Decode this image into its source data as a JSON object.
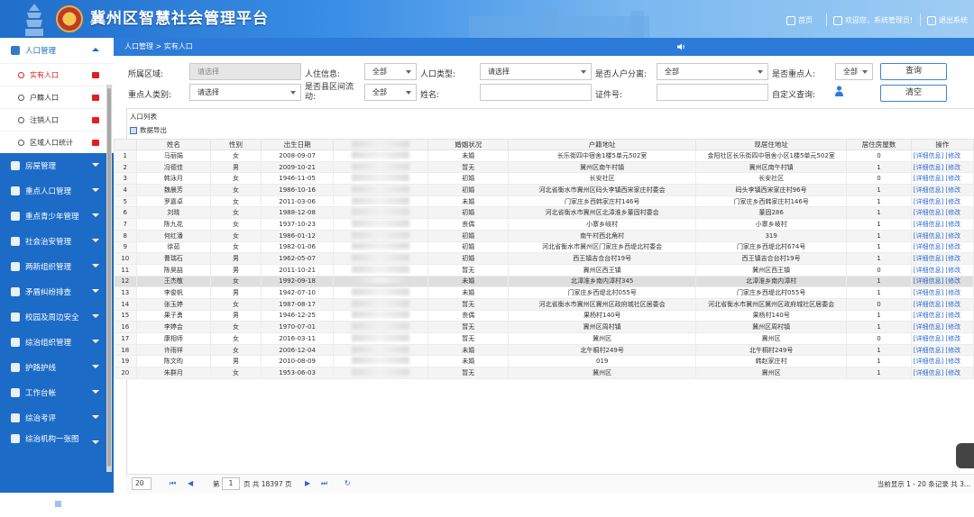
{
  "header": {
    "title": "冀州区智慧社会管理平台",
    "nav": [
      {
        "label": "首页",
        "icon": "home-icon"
      },
      {
        "label": "欢迎您，系统管理员!",
        "icon": "user-icon"
      },
      {
        "label": "退出系统",
        "icon": "logout-icon"
      }
    ]
  },
  "sidebar": {
    "active_group": "人口管理",
    "subitems": [
      {
        "label": "实有人口",
        "selected": true
      },
      {
        "label": "户籍人口",
        "selected": false
      },
      {
        "label": "注销人口",
        "selected": false
      },
      {
        "label": "区域人口统计",
        "selected": false
      }
    ],
    "groups": [
      "房屋管理",
      "重点人口管理",
      "重点青少年管理",
      "社会治安管理",
      "两新组织管理",
      "矛盾纠纷排查",
      "校园及周边安全",
      "综治组织管理",
      "护路护线",
      "工作台帐",
      "综治考评",
      "综治机构一张图"
    ]
  },
  "breadcrumb": "人口管理 > 实有人口",
  "filters": {
    "region_label": "所属区域:",
    "region_placeholder": "请选择",
    "residence_label": "人住信息:",
    "residence_value": "全部",
    "ptype_label": "人口类型:",
    "ptype_value": "请选择",
    "sep_label": "是否人户分离:",
    "sep_value": "全部",
    "key_label": "是否重点人:",
    "key_value": "全部",
    "category_label": "重点人类别:",
    "category_value": "请选择",
    "flow_label": "是否县区间流动:",
    "flow_value": "全部",
    "name_label": "姓名:",
    "name_value": "",
    "id_label": "证件号:",
    "id_value": "",
    "custom_label": "自定义查询:",
    "search_btn": "查询",
    "clear_btn": "清空"
  },
  "table": {
    "title": "人口列表",
    "export": "数据导出",
    "headers": [
      "",
      "姓名",
      "性别",
      "出生日期",
      "身份证号",
      "婚姻状况",
      "户籍地址",
      "现居住地址",
      "居住房屋数",
      "操作"
    ],
    "detail_label": "[详细信息]",
    "edit_label": "[修改",
    "rows": [
      {
        "n": "1",
        "name": "马丽娟",
        "sex": "女",
        "dob": "2008-09-07",
        "marry": "未婚",
        "hukou": "长乐街四中宿舍1楼5单元502室",
        "live": "金阳社区长乐街四中宿舍小区1楼5单元502室",
        "houses": "0"
      },
      {
        "n": "2",
        "name": "冯德佳",
        "sex": "男",
        "dob": "2009-10-21",
        "marry": "暂无",
        "hukou": "冀州区南午村镇",
        "live": "冀州区南午村镇",
        "houses": "1"
      },
      {
        "n": "3",
        "name": "韩泳月",
        "sex": "女",
        "dob": "1946-11-05",
        "marry": "初婚",
        "hukou": "长安社区",
        "live": "长安社区",
        "houses": "0"
      },
      {
        "n": "4",
        "name": "魏晨芳",
        "sex": "女",
        "dob": "1986-10-16",
        "marry": "初婚",
        "hukou": "河北省衡水市冀州区码头李镇西宋家庄村委会",
        "live": "码头李镇西宋家庄村96号",
        "houses": "1"
      },
      {
        "n": "5",
        "name": "罗嘉卓",
        "sex": "女",
        "dob": "2011-03-06",
        "marry": "未婚",
        "hukou": "门家庄乡西韩家庄村146号",
        "live": "门家庄乡西韩家庄村146号",
        "houses": "1"
      },
      {
        "n": "6",
        "name": "刘晓",
        "sex": "女",
        "dob": "1988-12-08",
        "marry": "初婚",
        "hukou": "河北省衡水市冀州区北漳淮乡董固村委会",
        "live": "董固286",
        "houses": "1"
      },
      {
        "n": "7",
        "name": "陈九花",
        "sex": "女",
        "dob": "1937-10-23",
        "marry": "丧偶",
        "hukou": "小寨乡岐村",
        "live": "小寨乡岐村",
        "houses": "1"
      },
      {
        "n": "8",
        "name": "何红潘",
        "sex": "女",
        "dob": "1986-01-12",
        "marry": "初婚",
        "hukou": "南午村西北角村",
        "live": "319",
        "houses": "1"
      },
      {
        "n": "9",
        "name": "徐茹",
        "sex": "女",
        "dob": "1982-01-06",
        "marry": "初婚",
        "hukou": "河北省衡水市冀州区门家庄乡西堤北村委会",
        "live": "门家庄乡西堤北村674号",
        "houses": "1"
      },
      {
        "n": "10",
        "name": "曹瑞石",
        "sex": "男",
        "dob": "1962-05-07",
        "marry": "初婚",
        "hukou": "西王镇吉合台村19号",
        "live": "西王镇吉合台村19号",
        "houses": "1"
      },
      {
        "n": "11",
        "name": "陈昊喆",
        "sex": "男",
        "dob": "2011-10-21",
        "marry": "暂无",
        "hukou": "冀州区西王镇",
        "live": "冀州区西王镇",
        "houses": "0"
      },
      {
        "n": "12",
        "name": "王杰敬",
        "sex": "女",
        "dob": "1992-09-18",
        "marry": "未婚",
        "hukou": "北漳淮乡南内漳村345",
        "live": "北漳淮乡南内漳村",
        "houses": "1"
      },
      {
        "n": "13",
        "name": "李俊帆",
        "sex": "男",
        "dob": "1942-07-10",
        "marry": "未婚",
        "hukou": "门家庄乡西堤北村055号",
        "live": "门家庄乡西堤北村055号",
        "houses": "1"
      },
      {
        "n": "14",
        "name": "张玉婷",
        "sex": "女",
        "dob": "1987-08-17",
        "marry": "暂无",
        "hukou": "河北省衡水市冀州区冀州区政府城社区居委会",
        "live": "河北省衡水市冀州区冀州区政府城社区居委会",
        "houses": "0"
      },
      {
        "n": "15",
        "name": "果子勇",
        "sex": "男",
        "dob": "1946-12-25",
        "marry": "丧偶",
        "hukou": "果杨村140号",
        "live": "果杨村140号",
        "houses": "1"
      },
      {
        "n": "16",
        "name": "李婷会",
        "sex": "女",
        "dob": "1970-07-01",
        "marry": "暂无",
        "hukou": "冀州区周村镇",
        "live": "冀州区周村镇",
        "houses": "1"
      },
      {
        "n": "17",
        "name": "康相师",
        "sex": "女",
        "dob": "2016-03-11",
        "marry": "暂无",
        "hukou": "冀州区",
        "live": "冀州区",
        "houses": "0"
      },
      {
        "n": "18",
        "name": "许雨祥",
        "sex": "女",
        "dob": "2006-12-04",
        "marry": "未婚",
        "hukou": "北午桐村249号",
        "live": "北午桐村249号",
        "houses": "1"
      },
      {
        "n": "19",
        "name": "陈文昀",
        "sex": "男",
        "dob": "2010-08-09",
        "marry": "未婚",
        "hukou": "019",
        "live": "韩赵家庄村",
        "houses": "1"
      },
      {
        "n": "20",
        "name": "朱群月",
        "sex": "女",
        "dob": "1953-06-03",
        "marry": "暂无",
        "hukou": "冀州区",
        "live": "冀州区",
        "houses": "1"
      }
    ]
  },
  "pager": {
    "page_size": "20",
    "page_prefix": "第",
    "page": "1",
    "page_suffix": "页 共 18397 页",
    "summary": "当前显示 1 - 20 条记录 共 3..."
  }
}
